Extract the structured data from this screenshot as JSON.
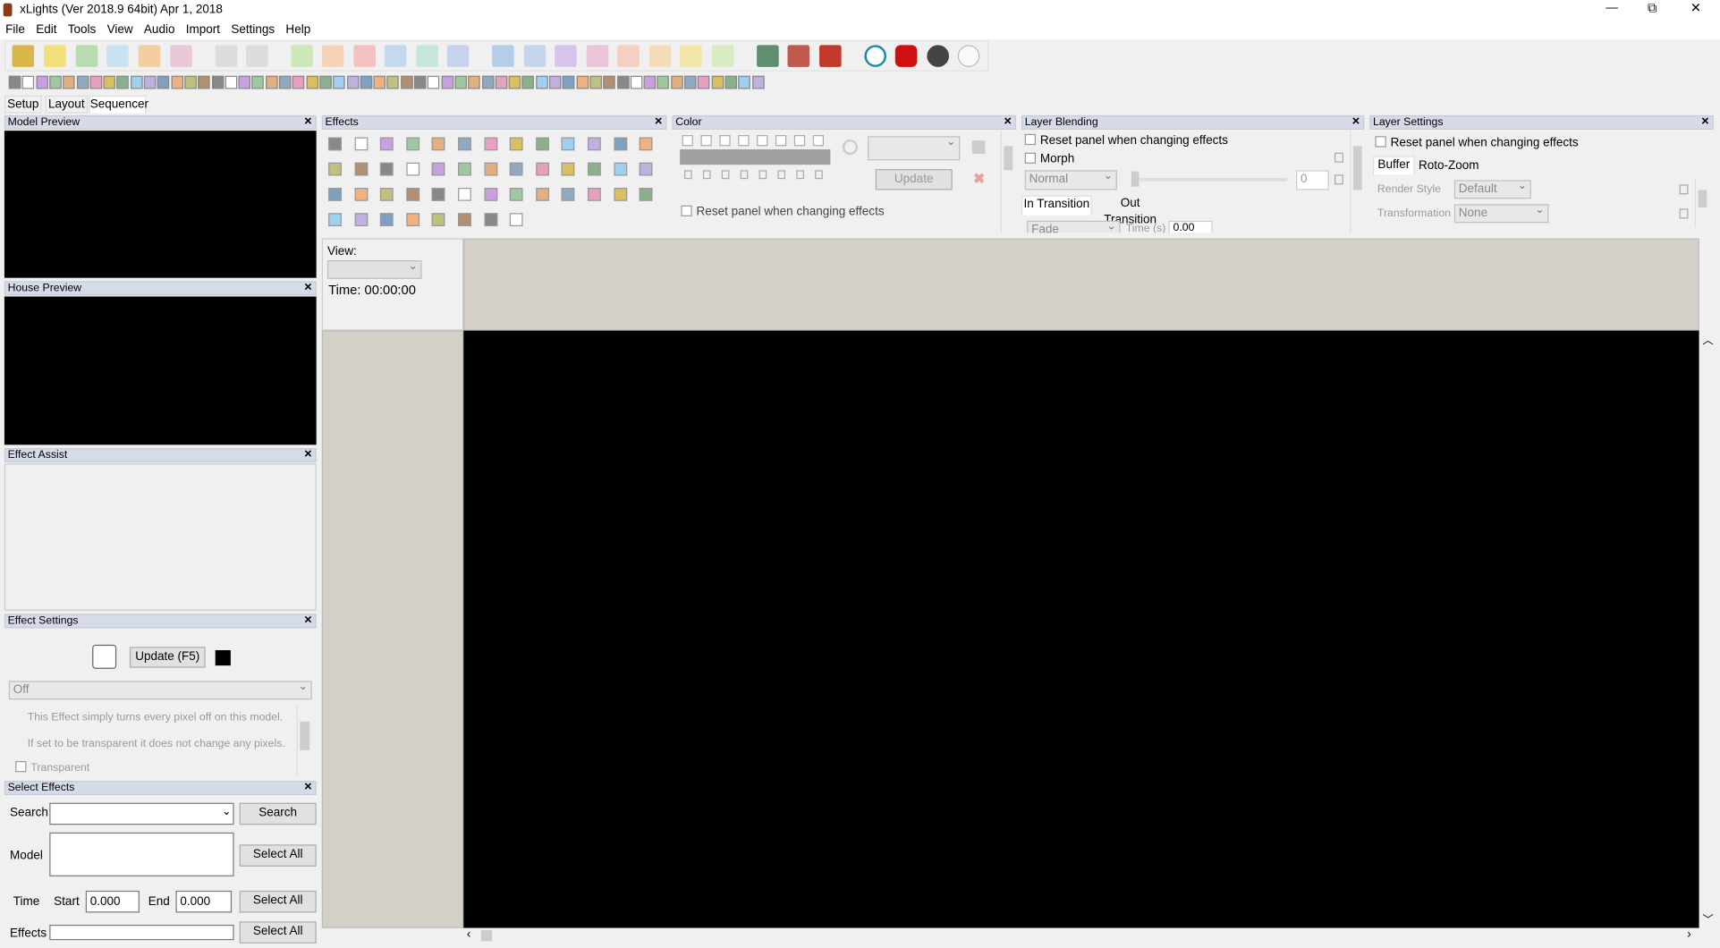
{
  "window": {
    "title": "xLights  (Ver 2018.9 64bit) Apr 1, 2018",
    "minimize": "—",
    "restore": "⧉",
    "close": "✕"
  },
  "menu": [
    "File",
    "Edit",
    "Tools",
    "View",
    "Audio",
    "Import",
    "Settings",
    "Help"
  ],
  "tabs": [
    "Setup",
    "Layout",
    "Sequencer"
  ],
  "panels": {
    "model_preview": {
      "title": "Model Preview"
    },
    "house_preview": {
      "title": "House Preview"
    },
    "effect_assist": {
      "title": "Effect Assist"
    },
    "effect_settings": {
      "title": "Effect Settings",
      "update": "Update (F5)",
      "effect_value": "Off",
      "desc1": "This Effect simply turns every pixel off on this model.",
      "desc2": "If set to be transparent it does not change any pixels.",
      "transparent": "Transparent"
    },
    "select_effects": {
      "title": "Select Effects",
      "search_label": "Search",
      "search_button": "Search",
      "model_label": "Model",
      "select_all": "Select All",
      "time_label": "Time",
      "start_label": "Start",
      "start_value": "0.000",
      "end_label": "End",
      "end_value": "0.000",
      "effects_label": "Effects"
    },
    "effects": {
      "title": "Effects"
    },
    "color": {
      "title": "Color",
      "update": "Update",
      "reset": "Reset panel when changing effects"
    },
    "layer_blending": {
      "title": "Layer Blending",
      "reset": "Reset panel when changing effects",
      "morph": "Morph",
      "mode": "Normal",
      "value": "0",
      "in_transition": "In Transition",
      "out_transition": "Out Transition",
      "fade": "Fade",
      "time_label": "Time (s)",
      "time_value": "0.00"
    },
    "layer_settings": {
      "title": "Layer Settings",
      "reset": "Reset panel when changing effects",
      "tab_buffer": "Buffer",
      "tab_roto": "Roto-Zoom",
      "render_style_label": "Render Style",
      "render_style": "Default",
      "transformation_label": "Transformation",
      "transformation": "None"
    }
  },
  "sequencer": {
    "view_label": "View:",
    "time": "Time: 00:00:00"
  },
  "colors": {
    "panel_header": "#d6dbe9",
    "timeline_bg": "#d4d0c8",
    "preview": "#000000"
  }
}
